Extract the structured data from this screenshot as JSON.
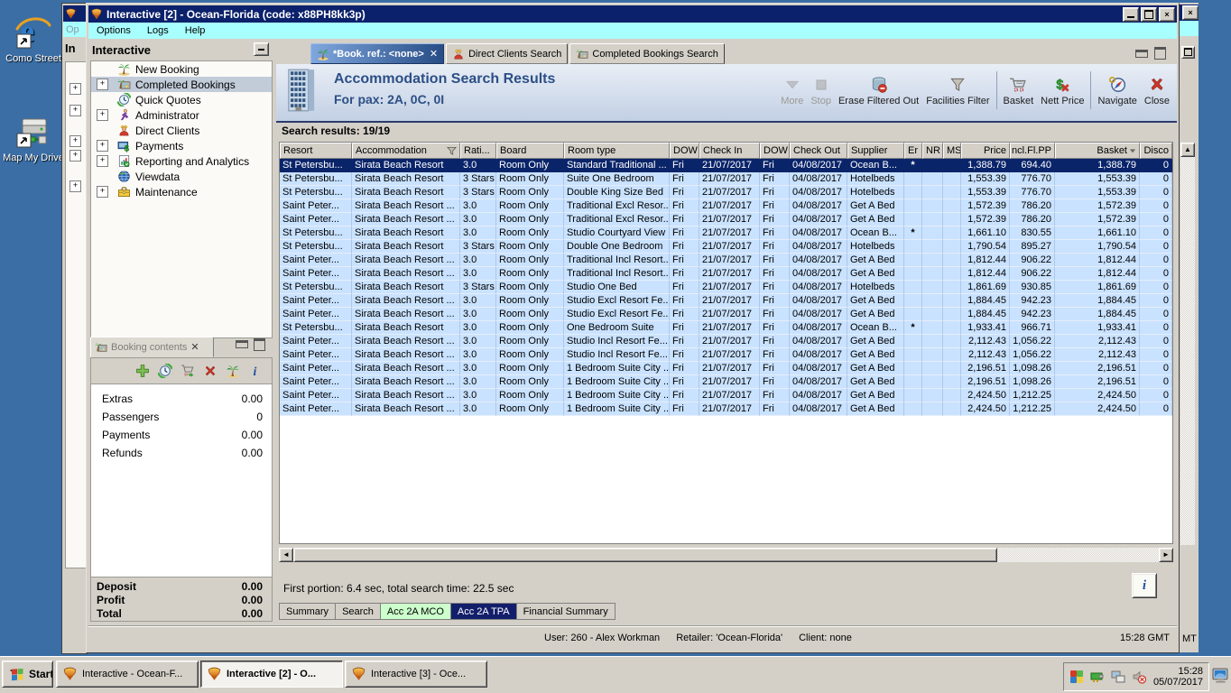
{
  "desktop": {
    "icons": [
      {
        "label": "Como Street",
        "icon": "ie-icon"
      },
      {
        "label": "Map My Drive",
        "icon": "drive-icon"
      }
    ]
  },
  "bg_windows": {
    "left_menu_fragment": "Op",
    "left_panel_fragment": "In",
    "right_status_fragment": "MT"
  },
  "window": {
    "title": "Interactive [2] - Ocean-Florida (code: x88PH8kk3p)",
    "menu": [
      "Options",
      "Logs",
      "Help"
    ]
  },
  "sidebar": {
    "title": "Interactive",
    "items": [
      {
        "label": "New Booking",
        "icon": "palm-icon",
        "expandable": false,
        "selected": false
      },
      {
        "label": "Completed Bookings",
        "icon": "resort-icon",
        "expandable": true,
        "selected": true
      },
      {
        "label": "Quick Quotes",
        "icon": "clock-icon",
        "expandable": false,
        "selected": false
      },
      {
        "label": "Administrator",
        "icon": "admin-icon",
        "expandable": true,
        "selected": false
      },
      {
        "label": "Direct Clients",
        "icon": "clients-icon",
        "expandable": false,
        "selected": false
      },
      {
        "label": "Payments",
        "icon": "payments-icon",
        "expandable": true,
        "selected": false
      },
      {
        "label": "Reporting and Analytics",
        "icon": "report-icon",
        "expandable": true,
        "selected": false
      },
      {
        "label": "Viewdata",
        "icon": "globe-icon",
        "expandable": false,
        "selected": false
      },
      {
        "label": "Maintenance",
        "icon": "toolbox-icon",
        "expandable": true,
        "selected": false
      }
    ]
  },
  "booking_contents": {
    "title": "Booking contents",
    "toolbar_icons": [
      "add-icon",
      "quick-quote-icon",
      "basket-go-icon",
      "delete-icon",
      "palm-icon",
      "info-icon"
    ],
    "rows": [
      {
        "label": "Extras",
        "value": "0.00"
      },
      {
        "label": "Passengers",
        "value": "0"
      },
      {
        "label": "Payments",
        "value": "0.00"
      },
      {
        "label": "Refunds",
        "value": "0.00"
      }
    ],
    "totals": [
      {
        "label": "Deposit",
        "value": "0.00"
      },
      {
        "label": "Profit",
        "value": "0.00"
      },
      {
        "label": "Total",
        "value": "0.00"
      }
    ]
  },
  "tabs": [
    {
      "label": "*Book. ref.: <none>",
      "icon": "palm-icon",
      "active": true,
      "closable": true
    },
    {
      "label": "Direct Clients Search",
      "icon": "clients-icon",
      "active": false,
      "closable": false
    },
    {
      "label": "Completed Bookings Search",
      "icon": "resort-icon",
      "active": false,
      "closable": false
    }
  ],
  "content": {
    "title": "Accommodation Search Results",
    "subtitle": "For pax: 2A, 0C, 0I",
    "toolbar": [
      {
        "label": "More",
        "icon": "more-icon",
        "disabled": true,
        "sep_after": false
      },
      {
        "label": "Stop",
        "icon": "stop-icon",
        "disabled": true,
        "sep_after": false
      },
      {
        "label": "Erase Filtered Out",
        "icon": "erase-icon",
        "disabled": false,
        "sep_after": false
      },
      {
        "label": "Facilities Filter",
        "icon": "funnel-icon",
        "disabled": false,
        "sep_after": true
      },
      {
        "label": "Basket",
        "icon": "cart-icon",
        "disabled": false,
        "sep_after": false
      },
      {
        "label": "Nett Price",
        "icon": "nett-icon",
        "disabled": false,
        "sep_after": true
      },
      {
        "label": "Navigate",
        "icon": "navigate-icon",
        "disabled": false,
        "sep_after": false
      },
      {
        "label": "Close",
        "icon": "closex-icon",
        "disabled": false,
        "sep_after": false
      }
    ],
    "results_label": "Search results: 19/19",
    "table": {
      "columns": [
        "Resort",
        "Accommodation",
        "Rati...",
        "Board",
        "Room type",
        "DOW",
        "Check In",
        "DOW",
        "Check Out",
        "Supplier",
        "Er",
        "NR",
        "MS",
        "Price",
        "Incl.Fl.PP",
        "Basket",
        "Disco"
      ],
      "filter_column": 1,
      "sort_column": 15,
      "selected_row": 0,
      "rows": [
        [
          "St Petersbu...",
          "Sirata Beach Resort",
          "3.0",
          "Room Only",
          "Standard Traditional ...",
          "Fri",
          "21/07/2017",
          "Fri",
          "04/08/2017",
          "Ocean B...",
          "*",
          "",
          "",
          "1,388.79",
          "694.40",
          "1,388.79",
          "0"
        ],
        [
          "St Petersbu...",
          "Sirata Beach Resort",
          "3 Stars",
          "Room Only",
          "Suite One Bedroom",
          "Fri",
          "21/07/2017",
          "Fri",
          "04/08/2017",
          "Hotelbeds",
          "",
          "",
          "",
          "1,553.39",
          "776.70",
          "1,553.39",
          "0"
        ],
        [
          "St Petersbu...",
          "Sirata Beach Resort",
          "3 Stars",
          "Room Only",
          "Double King Size Bed",
          "Fri",
          "21/07/2017",
          "Fri",
          "04/08/2017",
          "Hotelbeds",
          "",
          "",
          "",
          "1,553.39",
          "776.70",
          "1,553.39",
          "0"
        ],
        [
          "Saint Peter...",
          "Sirata Beach Resort ...",
          "3.0",
          "Room Only",
          "Traditional Excl Resor...",
          "Fri",
          "21/07/2017",
          "Fri",
          "04/08/2017",
          "Get A Bed",
          "",
          "",
          "",
          "1,572.39",
          "786.20",
          "1,572.39",
          "0"
        ],
        [
          "Saint Peter...",
          "Sirata Beach Resort ...",
          "3.0",
          "Room Only",
          "Traditional Excl Resor...",
          "Fri",
          "21/07/2017",
          "Fri",
          "04/08/2017",
          "Get A Bed",
          "",
          "",
          "",
          "1,572.39",
          "786.20",
          "1,572.39",
          "0"
        ],
        [
          "St Petersbu...",
          "Sirata Beach Resort",
          "3.0",
          "Room Only",
          "Studio Courtyard View",
          "Fri",
          "21/07/2017",
          "Fri",
          "04/08/2017",
          "Ocean B...",
          "*",
          "",
          "",
          "1,661.10",
          "830.55",
          "1,661.10",
          "0"
        ],
        [
          "St Petersbu...",
          "Sirata Beach Resort",
          "3 Stars",
          "Room Only",
          "Double One Bedroom",
          "Fri",
          "21/07/2017",
          "Fri",
          "04/08/2017",
          "Hotelbeds",
          "",
          "",
          "",
          "1,790.54",
          "895.27",
          "1,790.54",
          "0"
        ],
        [
          "Saint Peter...",
          "Sirata Beach Resort ...",
          "3.0",
          "Room Only",
          "Traditional Incl Resort...",
          "Fri",
          "21/07/2017",
          "Fri",
          "04/08/2017",
          "Get A Bed",
          "",
          "",
          "",
          "1,812.44",
          "906.22",
          "1,812.44",
          "0"
        ],
        [
          "Saint Peter...",
          "Sirata Beach Resort ...",
          "3.0",
          "Room Only",
          "Traditional Incl Resort...",
          "Fri",
          "21/07/2017",
          "Fri",
          "04/08/2017",
          "Get A Bed",
          "",
          "",
          "",
          "1,812.44",
          "906.22",
          "1,812.44",
          "0"
        ],
        [
          "St Petersbu...",
          "Sirata Beach Resort",
          "3 Stars",
          "Room Only",
          "Studio One Bed",
          "Fri",
          "21/07/2017",
          "Fri",
          "04/08/2017",
          "Hotelbeds",
          "",
          "",
          "",
          "1,861.69",
          "930.85",
          "1,861.69",
          "0"
        ],
        [
          "Saint Peter...",
          "Sirata Beach Resort ...",
          "3.0",
          "Room Only",
          "Studio Excl Resort Fe...",
          "Fri",
          "21/07/2017",
          "Fri",
          "04/08/2017",
          "Get A Bed",
          "",
          "",
          "",
          "1,884.45",
          "942.23",
          "1,884.45",
          "0"
        ],
        [
          "Saint Peter...",
          "Sirata Beach Resort ...",
          "3.0",
          "Room Only",
          "Studio Excl Resort Fe...",
          "Fri",
          "21/07/2017",
          "Fri",
          "04/08/2017",
          "Get A Bed",
          "",
          "",
          "",
          "1,884.45",
          "942.23",
          "1,884.45",
          "0"
        ],
        [
          "St Petersbu...",
          "Sirata Beach Resort",
          "3.0",
          "Room Only",
          "One Bedroom Suite",
          "Fri",
          "21/07/2017",
          "Fri",
          "04/08/2017",
          "Ocean B...",
          "*",
          "",
          "",
          "1,933.41",
          "966.71",
          "1,933.41",
          "0"
        ],
        [
          "Saint Peter...",
          "Sirata Beach Resort ...",
          "3.0",
          "Room Only",
          "Studio Incl Resort Fe...",
          "Fri",
          "21/07/2017",
          "Fri",
          "04/08/2017",
          "Get A Bed",
          "",
          "",
          "",
          "2,112.43",
          "1,056.22",
          "2,112.43",
          "0"
        ],
        [
          "Saint Peter...",
          "Sirata Beach Resort ...",
          "3.0",
          "Room Only",
          "Studio Incl Resort Fe...",
          "Fri",
          "21/07/2017",
          "Fri",
          "04/08/2017",
          "Get A Bed",
          "",
          "",
          "",
          "2,112.43",
          "1,056.22",
          "2,112.43",
          "0"
        ],
        [
          "Saint Peter...",
          "Sirata Beach Resort ...",
          "3.0",
          "Room Only",
          "1 Bedroom Suite City ...",
          "Fri",
          "21/07/2017",
          "Fri",
          "04/08/2017",
          "Get A Bed",
          "",
          "",
          "",
          "2,196.51",
          "1,098.26",
          "2,196.51",
          "0"
        ],
        [
          "Saint Peter...",
          "Sirata Beach Resort ...",
          "3.0",
          "Room Only",
          "1 Bedroom Suite City ...",
          "Fri",
          "21/07/2017",
          "Fri",
          "04/08/2017",
          "Get A Bed",
          "",
          "",
          "",
          "2,196.51",
          "1,098.26",
          "2,196.51",
          "0"
        ],
        [
          "Saint Peter...",
          "Sirata Beach Resort ...",
          "3.0",
          "Room Only",
          "1 Bedroom Suite City ...",
          "Fri",
          "21/07/2017",
          "Fri",
          "04/08/2017",
          "Get A Bed",
          "",
          "",
          "",
          "2,424.50",
          "1,212.25",
          "2,424.50",
          "0"
        ],
        [
          "Saint Peter...",
          "Sirata Beach Resort ...",
          "3.0",
          "Room Only",
          "1 Bedroom Suite City ...",
          "Fri",
          "21/07/2017",
          "Fri",
          "04/08/2017",
          "Get A Bed",
          "",
          "",
          "",
          "2,424.50",
          "1,212.25",
          "2,424.50",
          "0"
        ]
      ]
    },
    "status": "First portion: 6.4 sec, total search time: 22.5 sec",
    "info_button": "i",
    "bottom_tabs": [
      {
        "label": "Summary",
        "highlight": "none"
      },
      {
        "label": "Search",
        "highlight": "none"
      },
      {
        "label": "Acc 2A MCO",
        "highlight": "green"
      },
      {
        "label": "Acc 2A TPA",
        "highlight": "navy"
      },
      {
        "label": "Financial Summary",
        "highlight": "none"
      }
    ]
  },
  "statusbar": {
    "user": "User: 260 - Alex Workman",
    "retailer": "Retailer: 'Ocean-Florida'",
    "client": "Client: none",
    "time": "15:28 GMT"
  },
  "taskbar": {
    "start_label": "Start",
    "tasks": [
      {
        "label": "Interactive - Ocean-F...",
        "active": false
      },
      {
        "label": "Interactive [2] - O...",
        "active": true
      },
      {
        "label": "Interactive [3] - Oce...",
        "active": false
      }
    ],
    "tray_icons": [
      "antivirus-icon",
      "network-card-icon",
      "network-icon",
      "speaker-muted-icon"
    ],
    "tray_time": "15:28",
    "tray_date": "05/07/2017",
    "display_icon": "display-icon"
  },
  "colors": {
    "desktop": "#3A6EA5",
    "titlebar": "#0B216B",
    "menubar": "#A8FFFF",
    "chrome": "#D4D0C8",
    "row_blue": "#C9E2FF",
    "selected_row": "#0A246A",
    "heading_navy": "#2C4F86",
    "tab_green": "#CCFFCC",
    "tab_navy": "#131E6B"
  }
}
